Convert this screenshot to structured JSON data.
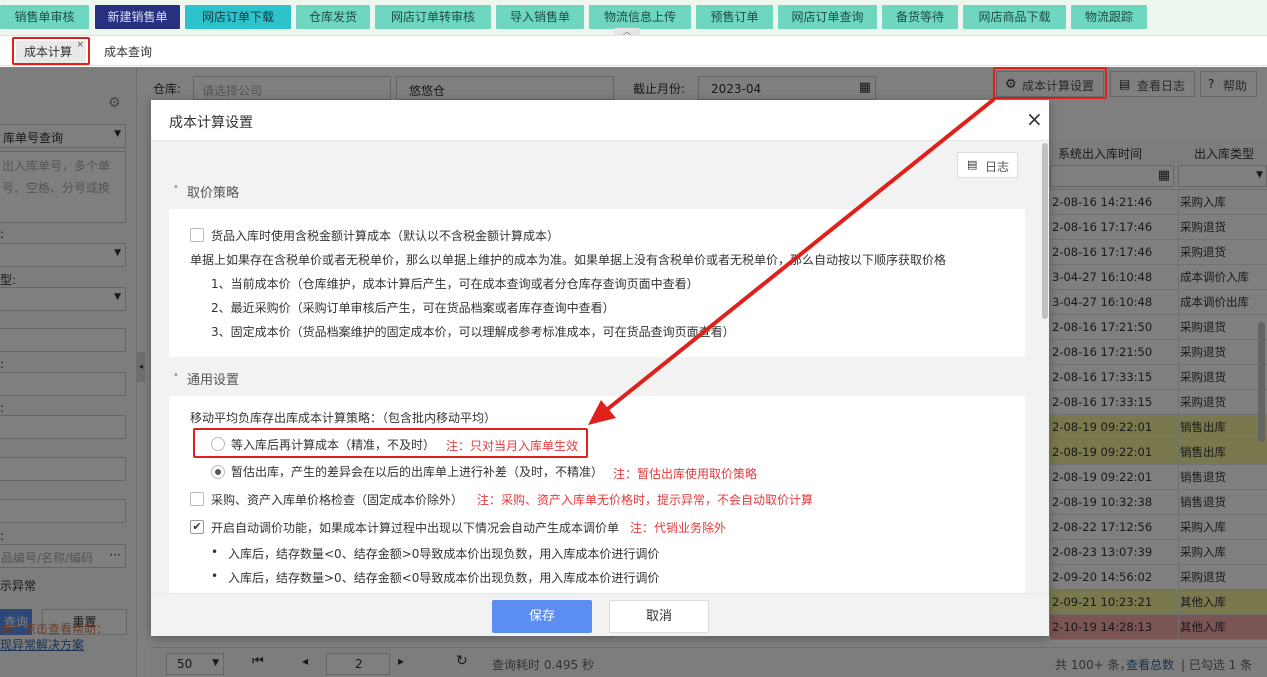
{
  "top_menu": [
    {
      "label": "销售单审核",
      "state": "normal"
    },
    {
      "label": "新建销售单",
      "state": "selected"
    },
    {
      "label": "网店订单下载",
      "state": "blue"
    },
    {
      "label": "仓库发货",
      "state": "normal"
    },
    {
      "label": "网店订单转审核",
      "state": "normal"
    },
    {
      "label": "导入销售单",
      "state": "normal"
    },
    {
      "label": "物流信息上传",
      "state": "normal"
    },
    {
      "label": "预售订单",
      "state": "normal"
    },
    {
      "label": "网店订单查询",
      "state": "normal"
    },
    {
      "label": "备货等待",
      "state": "normal"
    },
    {
      "label": "网店商品下载",
      "state": "normal"
    },
    {
      "label": "物流跟踪",
      "state": "normal"
    }
  ],
  "tabs": [
    {
      "label": "成本计算",
      "close": "×"
    },
    {
      "label": "成本查询"
    }
  ],
  "filters": {
    "warehouse_label": "仓库:",
    "company_placeholder": "请选择公司",
    "warehouse_value": "悠悠仓",
    "month_label": "截止月份:",
    "month_value": "2023-04"
  },
  "toolbar": {
    "settings": "成本计算设置",
    "log": "查看日志",
    "help": "帮助"
  },
  "left_panel": {
    "query_type": "库单号查询",
    "hint": "出入库单号，多个单号、空格、分号或换",
    "type_label": "型:",
    "field_placeholder": "品编号/名称/编码",
    "abnormal": "示异常",
    "footer_link1": "常？点击查看帮助：",
    "footer_link2": "现异常解决方案",
    "btn_query": "查询",
    "btn_reset": "重置"
  },
  "table": {
    "col_time": "系统出入库时间",
    "col_type": "出入库类型",
    "rows": [
      {
        "time": "2-08-16 14:21:46",
        "type": "采购入库",
        "hl": ""
      },
      {
        "time": "2-08-16 17:17:46",
        "type": "采购退货",
        "hl": ""
      },
      {
        "time": "2-08-16 17:17:46",
        "type": "采购退货",
        "hl": ""
      },
      {
        "time": "3-04-27 16:10:48",
        "type": "成本调价入库",
        "hl": ""
      },
      {
        "time": "3-04-27 16:10:48",
        "type": "成本调价出库",
        "hl": ""
      },
      {
        "time": "2-08-16 17:21:50",
        "type": "采购退货",
        "hl": ""
      },
      {
        "time": "2-08-16 17:21:50",
        "type": "采购退货",
        "hl": ""
      },
      {
        "time": "2-08-16 17:33:15",
        "type": "采购退货",
        "hl": ""
      },
      {
        "time": "2-08-16 17:33:15",
        "type": "采购退货",
        "hl": ""
      },
      {
        "time": "2-08-19 09:22:01",
        "type": "销售出库",
        "hl": "y"
      },
      {
        "time": "2-08-19 09:22:01",
        "type": "销售出库",
        "hl": "y"
      },
      {
        "time": "2-08-19 09:22:01",
        "type": "销售退货",
        "hl": ""
      },
      {
        "time": "2-08-19 10:32:38",
        "type": "销售退货",
        "hl": ""
      },
      {
        "time": "2-08-22 17:12:56",
        "type": "采购入库",
        "hl": ""
      },
      {
        "time": "2-08-23 13:07:39",
        "type": "采购入库",
        "hl": ""
      },
      {
        "time": "2-09-20 14:56:02",
        "type": "采购退货",
        "hl": ""
      },
      {
        "time": "2-09-21 10:23:21",
        "type": "其他入库",
        "hl": "y"
      },
      {
        "time": "2-10-19 14:28:13",
        "type": "其他入库",
        "hl": "r"
      }
    ]
  },
  "pagination": {
    "page_size": "50",
    "page": "2",
    "query_time": "查询耗时 0.495 秒",
    "total": "共 100+ 条，",
    "view_total": "查看总数",
    "selected": "| 已勾选 1 条"
  },
  "modal": {
    "title": "成本计算设置",
    "close": "×",
    "log_button": "日志",
    "section1": "取价策略",
    "tax_checkbox": "货品入库时使用含税金额计算成本（默认以不含税金额计算成本）",
    "tax_desc": "单据上如果存在含税单价或者无税单价，那么以单据上维护的成本为准。如果单据上没有含税单价或者无税单价，那么自动按以下顺序获取价格",
    "order": [
      "1、当前成本价（仓库维护，成本计算后产生，可在成本查询或者分仓库存查询页面中查看）",
      "2、最近采购价（采购订单审核后产生，可在货品档案或者库存查询中查看）",
      "3、固定成本价（货品档案维护的固定成本价，可以理解成参考标准成本，可在货品查询页面查看）"
    ],
    "section2": "通用设置",
    "strategy_label": "移动平均负库存出库成本计算策略：（包含批内移动平均）",
    "radio1": "等入库后再计算成本（精准，不及时）",
    "radio1_note": "注：只对当月入库单生效",
    "radio2": "暂估出库，产生的差异会在以后的出库单上进行补差（及时，不精准）",
    "radio2_note": "注：暂估出库使用取价策略",
    "check_purchase": "采购、资产入库单价格检查（固定成本价除外）",
    "check_purchase_note": "注：采购、资产入库单无价格时，提示异常，不会自动取价计算",
    "check_auto": "开启自动调价功能，如果成本计算过程中出现以下情况会自动产生成本调价单",
    "check_auto_note": "注：代销业务除外",
    "bullets": [
      "入库后，结存数量<0、结存金额>0导致成本价出现负数，用入库成本价进行调价",
      "入库后，结存数量>0、结存金额<0导致成本价出现负数，用入库成本价进行调价"
    ],
    "save": "保存",
    "cancel": "取消"
  },
  "colors": {
    "accent": "#5b8ef0",
    "annotation": "#e0201a",
    "menu_bg": "#6fd6c0"
  }
}
